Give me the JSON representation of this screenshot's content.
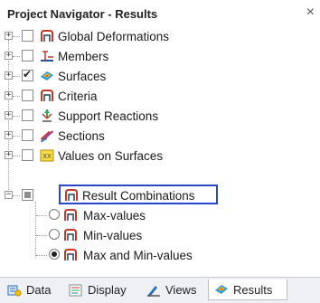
{
  "panel": {
    "title": "Project Navigator - Results",
    "close_glyph": "×"
  },
  "tree": {
    "items": [
      {
        "label": "Global Deformations",
        "checked": "none",
        "icon": "deformation-icon"
      },
      {
        "label": "Members",
        "checked": "none",
        "icon": "member-icon"
      },
      {
        "label": "Surfaces",
        "checked": "checked",
        "icon": "surface-icon"
      },
      {
        "label": "Criteria",
        "checked": "none",
        "icon": "criteria-icon"
      },
      {
        "label": "Support Reactions",
        "checked": "none",
        "icon": "support-icon"
      },
      {
        "label": "Sections",
        "checked": "none",
        "icon": "section-icon"
      },
      {
        "label": "Values on Surfaces",
        "checked": "none",
        "icon": "values-icon"
      },
      {
        "label": "Result Combinations",
        "checked": "partial",
        "icon": "result-combo-icon"
      }
    ],
    "sub_items": [
      {
        "label": "Max-values",
        "selected": false
      },
      {
        "label": "Min-values",
        "selected": false
      },
      {
        "label": "Max and Min-values",
        "selected": true
      }
    ]
  },
  "tabs": [
    {
      "label": "Data",
      "icon": "data-icon",
      "active": false
    },
    {
      "label": "Display",
      "icon": "display-icon",
      "active": false
    },
    {
      "label": "Views",
      "icon": "views-icon",
      "active": false
    },
    {
      "label": "Results",
      "icon": "results-icon",
      "active": true
    }
  ],
  "colors": {
    "selection_border": "#2747c8",
    "tab_bar": "#eef0f3"
  }
}
